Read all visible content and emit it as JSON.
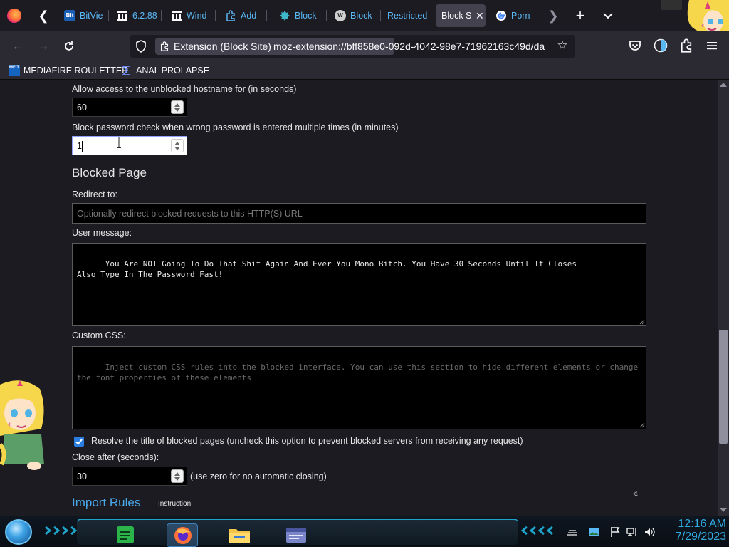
{
  "browser": {
    "tabs": [
      {
        "label": "BitVie",
        "favicon": "bitview-favicon",
        "fav_text": "Bit",
        "active": false
      },
      {
        "label": "6.2.88",
        "favicon": "archive-favicon",
        "active": false
      },
      {
        "label": "Wind",
        "favicon": "wind-favicon",
        "active": false
      },
      {
        "label": "Add-",
        "favicon": "puzzle-favicon",
        "active": false
      },
      {
        "label": "Block",
        "favicon": "blocksite-favicon",
        "active": false
      },
      {
        "label": "Block",
        "favicon": "wikipedia-favicon",
        "fav_text": "W",
        "active": false
      },
      {
        "label": "Restricted",
        "favicon": "none",
        "active": false
      },
      {
        "label": "Block S",
        "favicon": "none",
        "active": true
      },
      {
        "label": "Porn",
        "favicon": "google-favicon",
        "active": false
      }
    ],
    "identity_label": "Extension (Block Site)",
    "url": "moz-extension://bff858e0-092d-4042-98e7-71962163c49d/da",
    "bookmarks": [
      {
        "label": "MEDIAFIRE ROULETTER",
        "icon": "mediafire-icon",
        "icon_text": "MF T"
      },
      {
        "label": "ANAL PROLAPSE",
        "icon": "sigma-icon"
      }
    ]
  },
  "settings": {
    "allow_access_label": "Allow access to the unblocked hostname for (in seconds)",
    "allow_access_value": "60",
    "password_check_label": "Block password check when wrong password is entered multiple times (in minutes)",
    "password_check_value": "1",
    "blocked_page_heading": "Blocked Page",
    "redirect_label": "Redirect to:",
    "redirect_placeholder": "Optionally redirect blocked requests to this HTTP(S) URL",
    "user_message_label": "User message:",
    "user_message_value": "You Are NOT Going To Do That Shit Again And Ever You Mono Bitch. You Have 30 Seconds Until It Closes\nAlso Type In The Password Fast!",
    "custom_css_label": "Custom CSS:",
    "custom_css_placeholder": "Inject custom CSS rules into the blocked interface. You can use this section to hide different elements or change the font properties of these elements",
    "resolve_title_label": "Resolve the title of blocked pages (uncheck this option to prevent blocked servers from receiving any request)",
    "resolve_title_checked": true,
    "close_after_label": "Close after (seconds):",
    "close_after_value": "30",
    "close_after_hint": "(use zero for no automatic closing)",
    "import_rules_heading": "Import Rules",
    "instruction_link": "Instruction"
  },
  "taskbar": {
    "time": "12:16 AM",
    "date": "7/29/2023",
    "apps": [
      "sticky-notes-icon",
      "firefox-icon",
      "file-explorer-icon",
      "window-app-icon"
    ],
    "tray": [
      "keyboard-icon",
      "photo-icon",
      "flag-icon",
      "network-icon",
      "volume-icon"
    ]
  },
  "colors": {
    "accent": "#2a7de1",
    "link": "#4aa8e8",
    "tab_link": "#5ab8f5",
    "clock": "#30aadf"
  }
}
